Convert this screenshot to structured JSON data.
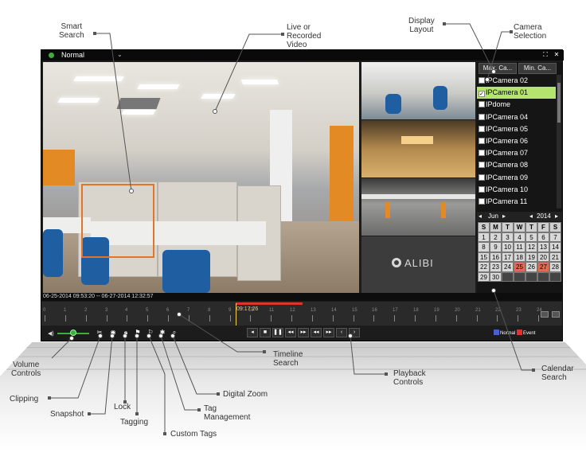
{
  "window": {
    "mode": "Normal",
    "maximize_icon": "fullscreen-icon",
    "close_icon": "close-icon"
  },
  "side_panel": {
    "tabs": [
      "Max. Ca...",
      "Min. Ca..."
    ],
    "cameras": [
      {
        "label": "IPCamera 02",
        "checked": false
      },
      {
        "label": "IPCamera 01",
        "checked": true
      },
      {
        "label": "IPdome",
        "checked": false
      },
      {
        "label": "IPCamera 04",
        "checked": false
      },
      {
        "label": "IPCamera 05",
        "checked": false
      },
      {
        "label": "IPCamera 06",
        "checked": false
      },
      {
        "label": "IPCamera 07",
        "checked": false
      },
      {
        "label": "IPCamera 08",
        "checked": false
      },
      {
        "label": "IPCamera 09",
        "checked": false
      },
      {
        "label": "IPCamera 10",
        "checked": false
      },
      {
        "label": "IPCamera 11",
        "checked": false
      }
    ],
    "calendar": {
      "month": "Jun",
      "year": "2014",
      "weekdays": [
        "S",
        "M",
        "T",
        "W",
        "T",
        "F",
        "S"
      ],
      "weeks": [
        [
          "1",
          "2",
          "3",
          "4",
          "5",
          "6",
          "7"
        ],
        [
          "8",
          "9",
          "10",
          "11",
          "12",
          "13",
          "14"
        ],
        [
          "15",
          "16",
          "17",
          "18",
          "19",
          "20",
          "21"
        ],
        [
          "22",
          "23",
          "24",
          "25",
          "26",
          "27",
          "28"
        ],
        [
          "29",
          "30",
          "",
          "",
          "",
          "",
          ""
        ]
      ],
      "highlighted_days": [
        "25",
        "27"
      ]
    }
  },
  "playback": {
    "range_text": "06-25-2014 09:53:20 -- 06-27-2014 12:32:57",
    "cursor_time": "09:17:26",
    "tick_labels": [
      "0",
      "1",
      "2",
      "3",
      "4",
      "5",
      "6",
      "7",
      "8",
      "9",
      "10",
      "11",
      "12",
      "13",
      "14",
      "15",
      "16",
      "17",
      "18",
      "19",
      "20",
      "21",
      "22",
      "23",
      "24"
    ],
    "legend": {
      "normal": "Normal",
      "event": "Event"
    },
    "colors": {
      "normal": "#4a5fd6",
      "event": "#d9352b",
      "cursor": "#f2d24b"
    }
  },
  "brand": "ALIBI",
  "callouts": {
    "smart_search": "Smart\nSearch",
    "live_video": "Live or\nRecorded\nVideo",
    "display_layout": "Display\nLayout",
    "camera_selection": "Camera\nSelection",
    "volume_controls": "Volume\nControls",
    "clipping": "Clipping",
    "snapshot": "Snapshot",
    "lock": "Lock",
    "tagging": "Tagging",
    "custom_tags": "Custom Tags",
    "tag_management": "Tag\nManagement",
    "digital_zoom": "Digital Zoom",
    "timeline_search": "Timeline\nSearch",
    "playback_controls": "Playback\nControls",
    "calendar_search": "Calendar\nSearch"
  }
}
